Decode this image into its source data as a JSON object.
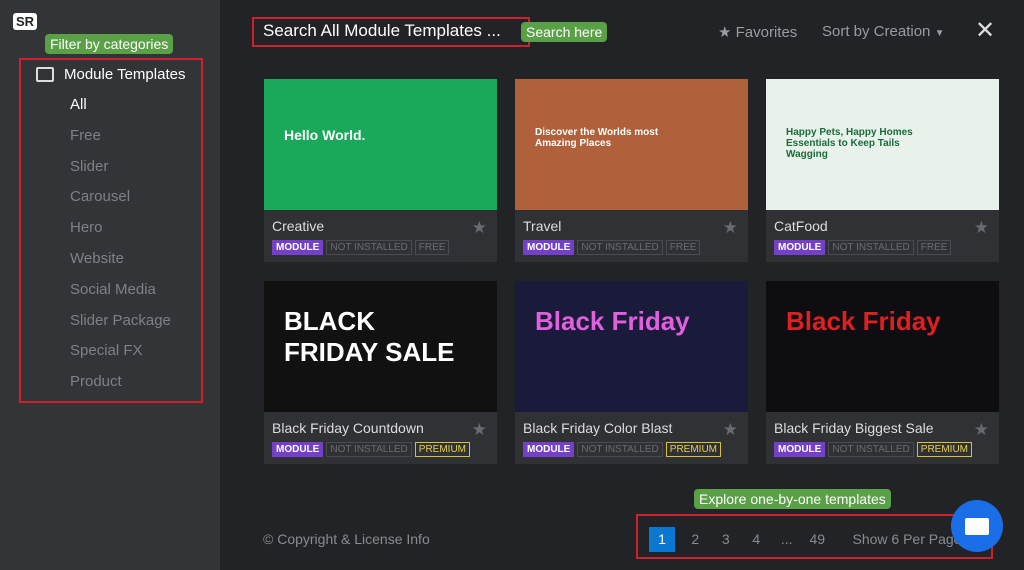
{
  "logo": "SR",
  "annotations": {
    "filter": "Filter by categories",
    "search": "Search here",
    "explore": "Explore one-by-one templates"
  },
  "sidebar": {
    "heading": "Module Templates",
    "items": [
      "All",
      "Free",
      "Slider",
      "Carousel",
      "Hero",
      "Website",
      "Social Media",
      "Slider Package",
      "Special FX",
      "Product"
    ],
    "active": "All"
  },
  "header": {
    "search_placeholder": "Search All Module Templates ...",
    "favorites": "Favorites",
    "sort": "Sort by Creation",
    "close": "✕"
  },
  "cards": [
    {
      "title": "Creative",
      "thumb_text": "Hello World.",
      "tags": [
        "MODULE",
        "NOT INSTALLED",
        "FREE"
      ],
      "bg": "#1aa85a"
    },
    {
      "title": "Travel",
      "thumb_text": "Discover the Worlds most Amazing Places",
      "tags": [
        "MODULE",
        "NOT INSTALLED",
        "FREE"
      ],
      "bg": "#b0603a"
    },
    {
      "title": "CatFood",
      "thumb_text": "Happy Pets, Happy Homes Essentials to Keep Tails Wagging",
      "tags": [
        "MODULE",
        "NOT INSTALLED",
        "FREE"
      ],
      "bg": "#e8f2ea"
    },
    {
      "title": "Black Friday Countdown",
      "thumb_text": "BLACK FRIDAY SALE",
      "tags": [
        "MODULE",
        "NOT INSTALLED",
        "PREMIUM"
      ],
      "bg": "#111"
    },
    {
      "title": "Black Friday Color Blast",
      "thumb_text": "Black Friday",
      "tags": [
        "MODULE",
        "NOT INSTALLED",
        "PREMIUM"
      ],
      "bg": "#1a1b3a"
    },
    {
      "title": "Black Friday Biggest Sale",
      "thumb_text": "Black Friday",
      "tags": [
        "MODULE",
        "NOT INSTALLED",
        "PREMIUM"
      ],
      "bg": "#0d0d12"
    }
  ],
  "footer": {
    "copyright": "© Copyright & License Info",
    "pages": [
      "1",
      "2",
      "3",
      "4",
      "...",
      "49"
    ],
    "current_page": "1",
    "per_page": "Show 6 Per Page"
  }
}
